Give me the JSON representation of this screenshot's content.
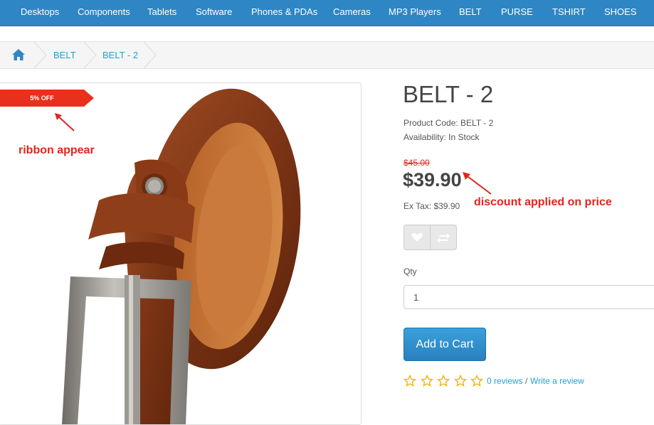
{
  "nav": {
    "items": [
      "Desktops",
      "Components",
      "Tablets",
      "Software",
      "Phones & PDAs",
      "Cameras",
      "MP3 Players",
      "BELT",
      "PURSE",
      "TSHIRT",
      "SHOES"
    ]
  },
  "breadcrumb": {
    "home_icon": "home-icon",
    "items": [
      "BELT",
      "BELT - 2"
    ]
  },
  "ribbon": {
    "text": "5% OFF",
    "color": "#e8301c"
  },
  "annotations": {
    "ribbon_note": "ribbon appear",
    "price_note": "discount applied on price",
    "color": "#e0261d"
  },
  "product": {
    "title": "BELT - 2",
    "code_line": "Product Code: BELT - 2",
    "availability_line": "Availability: In Stock",
    "old_price": "$45.00",
    "price": "$39.90",
    "ex_tax": "Ex Tax: $39.90",
    "wishlist_icon": "heart-icon",
    "compare_icon": "exchange-icon",
    "qty_label": "Qty",
    "qty_value": "1",
    "add_to_cart": "Add to Cart",
    "rating": 0,
    "reviews_link": "0 reviews",
    "review_separator": "/",
    "write_review": "Write a review"
  }
}
